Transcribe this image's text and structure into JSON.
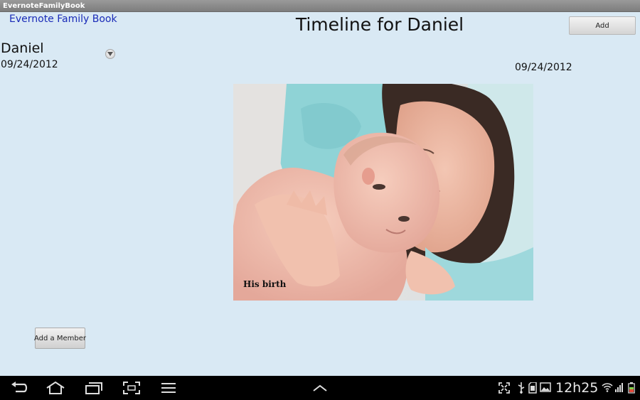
{
  "window": {
    "title": "EvernoteFamilyBook"
  },
  "header": {
    "app_link": "Evernote Family Book",
    "page_title": "Timeline for Daniel",
    "add_label": "Add"
  },
  "sidebar": {
    "member_name": "Daniel",
    "member_date": "09/24/2012",
    "add_member_label": "Add a Member"
  },
  "timeline": {
    "entries": [
      {
        "date": "09/24/2012",
        "caption": "His birth"
      }
    ]
  },
  "system_bar": {
    "clock": "12h25",
    "nav_icons": [
      "back-icon",
      "home-icon",
      "recent-apps-icon",
      "screenshot-icon",
      "menu-icon",
      "chevron-up-icon"
    ],
    "status_icons": [
      "fullscreen-icon",
      "usb-icon",
      "sd-card-icon",
      "gallery-icon",
      "wifi-icon",
      "signal-icon",
      "battery-icon"
    ]
  },
  "colors": {
    "background": "#d9e9f4",
    "link": "#1a2bb8",
    "navbar": "#000000"
  }
}
